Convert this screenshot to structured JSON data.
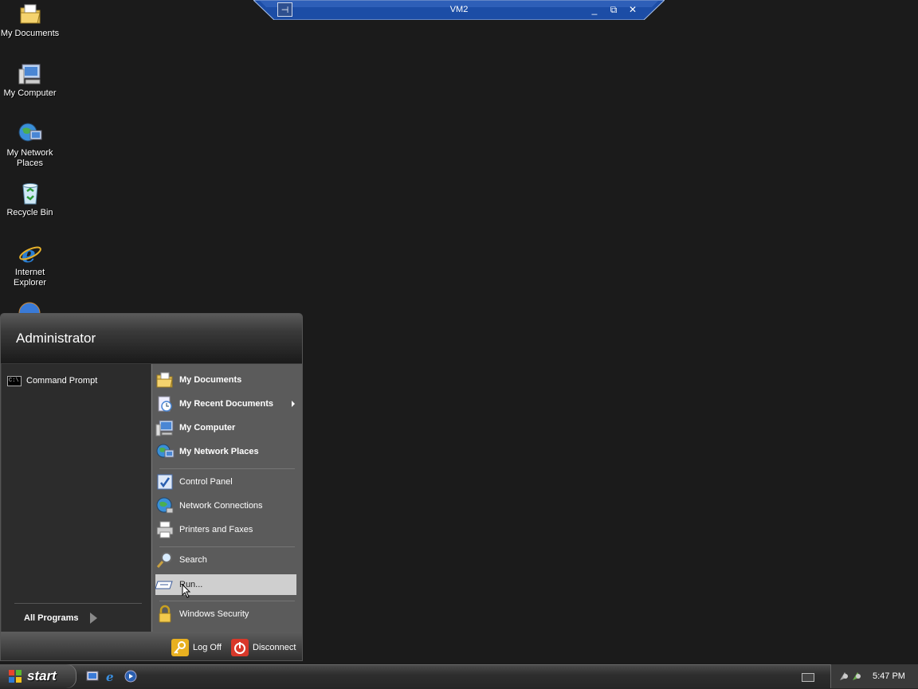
{
  "desktop": {
    "icons": [
      {
        "label": "My Documents",
        "icon": "my-documents-icon"
      },
      {
        "label": "My Computer",
        "icon": "my-computer-icon"
      },
      {
        "label": "My Network Places",
        "icon": "my-network-places-icon"
      },
      {
        "label": "Recycle Bin",
        "icon": "recycle-bin-icon"
      },
      {
        "label": "Internet Explorer",
        "icon": "internet-explorer-icon"
      }
    ]
  },
  "remote_bar": {
    "title": "VM2",
    "pin_glyph": "⊣",
    "minimize": "_",
    "restore": "⧉",
    "close": "✕"
  },
  "start_menu": {
    "user": "Administrator",
    "pinned": [
      {
        "label": "Command Prompt",
        "icon": "command-prompt-icon"
      }
    ],
    "all_programs": "All Programs",
    "right_items": [
      {
        "label": "My Documents",
        "icon": "my-documents-icon",
        "bold": true
      },
      {
        "label": "My Recent Documents",
        "icon": "recent-documents-icon",
        "bold": true,
        "submenu": true
      },
      {
        "label": "My Computer",
        "icon": "my-computer-icon",
        "bold": true
      },
      {
        "label": "My Network Places",
        "icon": "my-network-places-icon",
        "bold": true
      },
      {
        "label": "Control Panel",
        "icon": "control-panel-icon"
      },
      {
        "label": "Network Connections",
        "icon": "network-connections-icon"
      },
      {
        "label": "Printers and Faxes",
        "icon": "printers-faxes-icon"
      },
      {
        "label": "Search",
        "icon": "search-icon"
      },
      {
        "label": "Run...",
        "icon": "run-icon",
        "highlighted": true
      },
      {
        "label": "Windows Security",
        "icon": "windows-security-icon"
      }
    ],
    "footer": {
      "log_off": "Log Off",
      "disconnect": "Disconnect"
    }
  },
  "taskbar": {
    "start_label": "start",
    "quick_launch": [
      "desktop-icon",
      "internet-explorer-icon",
      "media-player-icon"
    ],
    "clock": "5:47 PM"
  },
  "colors": {
    "desktop": "#1b1b1b",
    "remote_bar": "#1e4aa8",
    "highlight": "#cfcfcf"
  }
}
